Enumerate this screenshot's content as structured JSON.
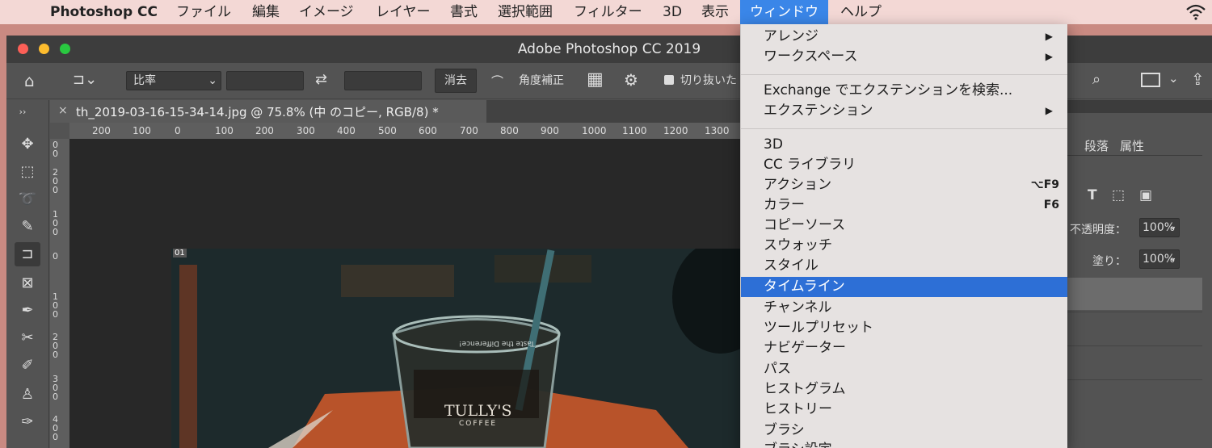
{
  "menubar": {
    "apple": "",
    "app": "Photoshop CC",
    "items": [
      "ファイル",
      "編集",
      "イメージ",
      "レイヤー",
      "書式",
      "選択範囲",
      "フィルター",
      "3D",
      "表示",
      "ウィンドウ",
      "ヘルプ"
    ],
    "wifi_icon": "wifi-icon"
  },
  "window": {
    "title": "Adobe Photoshop CC 2019"
  },
  "options": {
    "ratio_label": "比率",
    "clear_button": "消去",
    "straighten_label": "角度補正",
    "delete_cropped_label": "切り抜いた"
  },
  "document": {
    "tab_title": "th_2019-03-16-15-34-14.jpg @ 75.8% (中 のコピー, RGB/8) *",
    "slice_label": "01",
    "ruler_ticks": [
      "200",
      "100",
      "0",
      "100",
      "200",
      "300",
      "400",
      "500",
      "600",
      "700",
      "800",
      "900",
      "1000",
      "1100",
      "1200",
      "1300"
    ],
    "ruler_left": [
      "0 0",
      "2 0 0",
      "1 0 0",
      "0",
      "1 0 0",
      "2 0 0",
      "3 0 0",
      "4 0 0"
    ],
    "logo_text": "TULLY'S",
    "logo_sub": "COFFEE",
    "glass_text": "Taste the Difference!"
  },
  "panels": {
    "tabs": [
      "段落",
      "属性"
    ],
    "opacity_label": "不透明度：",
    "opacity_value": "100%",
    "fill_label": "塗り：",
    "fill_value": "100%"
  },
  "window_menu": {
    "items": [
      {
        "label": "アレンジ",
        "submenu": true
      },
      {
        "label": "ワークスペース",
        "submenu": true
      },
      {
        "label": "Exchange でエクステンションを検索..."
      },
      {
        "label": "エクステンション",
        "submenu": true
      },
      {
        "label": "3D"
      },
      {
        "label": "CC ライブラリ"
      },
      {
        "label": "アクション",
        "shortcut": "⌥F9"
      },
      {
        "label": "カラー",
        "shortcut": "F6"
      },
      {
        "label": "コピーソース"
      },
      {
        "label": "スウォッチ"
      },
      {
        "label": "スタイル"
      },
      {
        "label": "タイムライン",
        "highlighted": true
      },
      {
        "label": "チャンネル"
      },
      {
        "label": "ツールプリセット"
      },
      {
        "label": "ナビゲーター"
      },
      {
        "label": "パス"
      },
      {
        "label": "ヒストグラム"
      },
      {
        "label": "ヒストリー"
      },
      {
        "label": "ブラシ"
      },
      {
        "label": "ブラシ設定"
      }
    ]
  },
  "colors": {
    "highlight": "#2d6fd6",
    "menubar_active": "#3a86e8",
    "menu_bg": "#e6e2e1"
  }
}
